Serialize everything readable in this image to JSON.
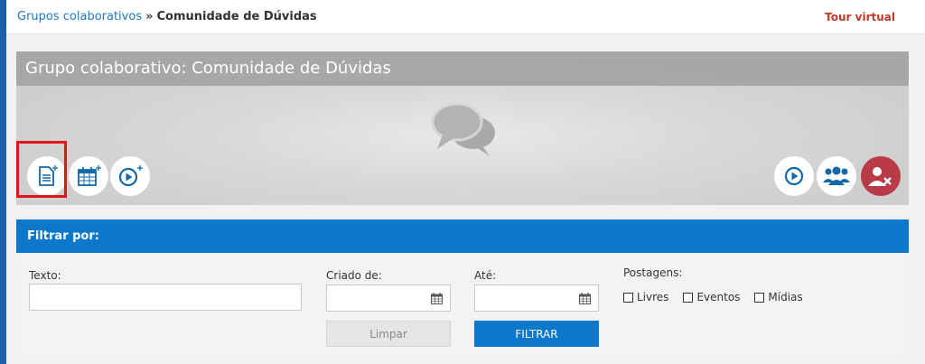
{
  "breadcrumb": {
    "parent": "Grupos colaborativos",
    "separator": "»",
    "current": "Comunidade de Dúvidas"
  },
  "tour_link": "Tour virtual",
  "banner": {
    "title": "Grupo colaborativo: Comunidade de Dúvidas",
    "left_actions": [
      "new-post-icon",
      "new-event-icon",
      "new-media-icon"
    ],
    "right_actions": [
      "media-play-icon",
      "members-icon",
      "leave-group-icon"
    ]
  },
  "filter": {
    "header": "Filtrar por:",
    "texto_label": "Texto:",
    "criado_label": "Criado de:",
    "ate_label": "Até:",
    "postagens_label": "Postagens:",
    "checkboxes": [
      "Livres",
      "Eventos",
      "Mídias"
    ],
    "limpar": "Limpar",
    "filtrar": "FILTRAR"
  },
  "colors": {
    "accent_blue": "#0d78c9",
    "danger_red": "#b93b47",
    "link_blue": "#1f79bf",
    "tour_red": "#c0392b"
  }
}
